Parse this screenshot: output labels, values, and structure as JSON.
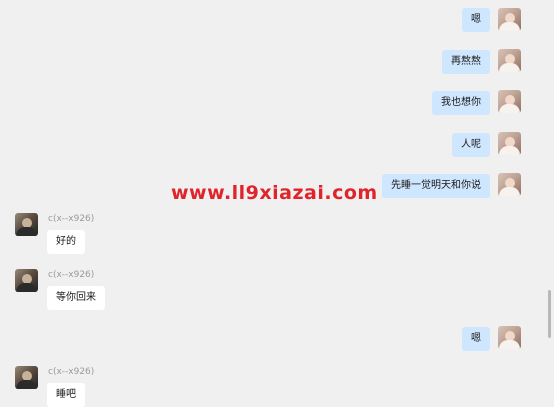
{
  "messages": [
    {
      "from": "me",
      "text": "嗯"
    },
    {
      "from": "me",
      "text": "再熬熬"
    },
    {
      "from": "me",
      "text": "我也想你"
    },
    {
      "from": "me",
      "text": "人呢"
    },
    {
      "from": "me",
      "text": "先睡一觉明天和你说"
    },
    {
      "from": "them",
      "sender": "c(x--x926)",
      "text": "好的"
    },
    {
      "from": "them",
      "sender": "c(x--x926)",
      "text": "等你回来"
    },
    {
      "from": "me",
      "text": "嗯"
    },
    {
      "from": "them",
      "sender": "c(x--x926)",
      "text": "睡吧"
    }
  ],
  "watermark": "www.ll9xiazai.com"
}
